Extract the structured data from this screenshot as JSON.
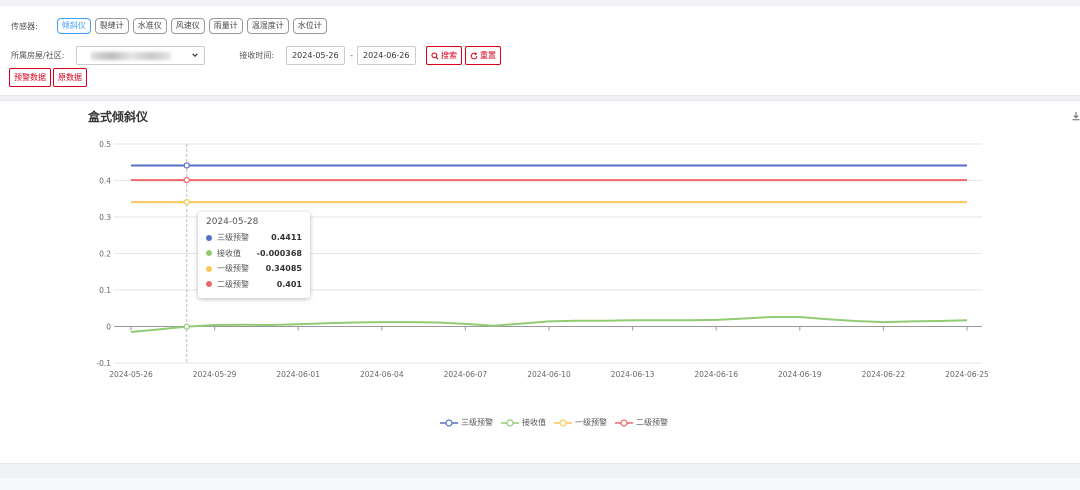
{
  "filter": {
    "sensor_label": "传感器:",
    "sensors": [
      "倾斜仪",
      "裂缝计",
      "水准仪",
      "风速仪",
      "雨量计",
      "温湿度计",
      "水位计"
    ],
    "active_sensor": "倾斜仪",
    "district_label": "所属房屋/社区:",
    "time_label": "接收时间:",
    "date_from": "2024-05-26",
    "date_sep": "-",
    "date_to": "2024-06-26",
    "search_label": "搜索",
    "reset_label": "重置",
    "warning_data_label": "预警数据",
    "raw_data_label": "原数据"
  },
  "chart_data": {
    "type": "line",
    "title": "盒式倾斜仪",
    "x": [
      "2024-05-26",
      "2024-05-27",
      "2024-05-28",
      "2024-05-29",
      "2024-05-30",
      "2024-05-31",
      "2024-06-01",
      "2024-06-02",
      "2024-06-03",
      "2024-06-04",
      "2024-06-05",
      "2024-06-06",
      "2024-06-07",
      "2024-06-08",
      "2024-06-09",
      "2024-06-10",
      "2024-06-11",
      "2024-06-12",
      "2024-06-13",
      "2024-06-14",
      "2024-06-15",
      "2024-06-16",
      "2024-06-17",
      "2024-06-18",
      "2024-06-19",
      "2024-06-20",
      "2024-06-21",
      "2024-06-22",
      "2024-06-23",
      "2024-06-24",
      "2024-06-25"
    ],
    "x_tick_labels": [
      "2024-05-26",
      "2024-05-29",
      "2024-06-01",
      "2024-06-04",
      "2024-06-07",
      "2024-06-10",
      "2024-06-13",
      "2024-06-16",
      "2024-06-19",
      "2024-06-22",
      "2024-06-25"
    ],
    "ylim": [
      -0.1,
      0.5
    ],
    "y_ticks": [
      "-0.1",
      "0",
      "0.1",
      "0.2",
      "0.3",
      "0.4",
      "0.5"
    ],
    "grid": true,
    "legend_position": "bottom",
    "series": [
      {
        "name": "三级预警",
        "color": "#5470c6",
        "values": [
          0.4411,
          0.4411,
          0.4411,
          0.4411,
          0.4411,
          0.4411,
          0.4411,
          0.4411,
          0.4411,
          0.4411,
          0.4411,
          0.4411,
          0.4411,
          0.4411,
          0.4411,
          0.4411,
          0.4411,
          0.4411,
          0.4411,
          0.4411,
          0.4411,
          0.4411,
          0.4411,
          0.4411,
          0.4411,
          0.4411,
          0.4411,
          0.4411,
          0.4411,
          0.4411,
          0.4411
        ]
      },
      {
        "name": "接收值",
        "color": "#91cc75",
        "values": [
          -0.015,
          -0.008,
          -0.000368,
          0.004,
          0.005,
          0.004,
          0.006,
          0.009,
          0.011,
          0.012,
          0.012,
          0.011,
          0.007,
          0.002,
          0.008,
          0.014,
          0.016,
          0.016,
          0.017,
          0.017,
          0.017,
          0.018,
          0.022,
          0.026,
          0.026,
          0.02,
          0.015,
          0.012,
          0.014,
          0.015,
          0.017
        ]
      },
      {
        "name": "一级预警",
        "color": "#fac858",
        "values": [
          0.34085,
          0.34085,
          0.34085,
          0.34085,
          0.34085,
          0.34085,
          0.34085,
          0.34085,
          0.34085,
          0.34085,
          0.34085,
          0.34085,
          0.34085,
          0.34085,
          0.34085,
          0.34085,
          0.34085,
          0.34085,
          0.34085,
          0.34085,
          0.34085,
          0.34085,
          0.34085,
          0.34085,
          0.34085,
          0.34085,
          0.34085,
          0.34085,
          0.34085,
          0.34085,
          0.34085
        ]
      },
      {
        "name": "二级预警",
        "color": "#ee6666",
        "values": [
          0.401,
          0.401,
          0.401,
          0.401,
          0.401,
          0.401,
          0.401,
          0.401,
          0.401,
          0.401,
          0.401,
          0.401,
          0.401,
          0.401,
          0.401,
          0.401,
          0.401,
          0.401,
          0.401,
          0.401,
          0.401,
          0.401,
          0.401,
          0.401,
          0.401,
          0.401,
          0.401,
          0.401,
          0.401,
          0.401,
          0.401
        ]
      }
    ],
    "tooltip": {
      "date": "2024-05-28",
      "rows": [
        {
          "name": "三级预警",
          "value": "0.4411",
          "color": "#5470c6"
        },
        {
          "name": "接收值",
          "value": "-0.000368",
          "color": "#91cc75"
        },
        {
          "name": "一级预警",
          "value": "0.34085",
          "color": "#fac858"
        },
        {
          "name": "二级预警",
          "value": "0.401",
          "color": "#ee6666"
        }
      ]
    }
  }
}
